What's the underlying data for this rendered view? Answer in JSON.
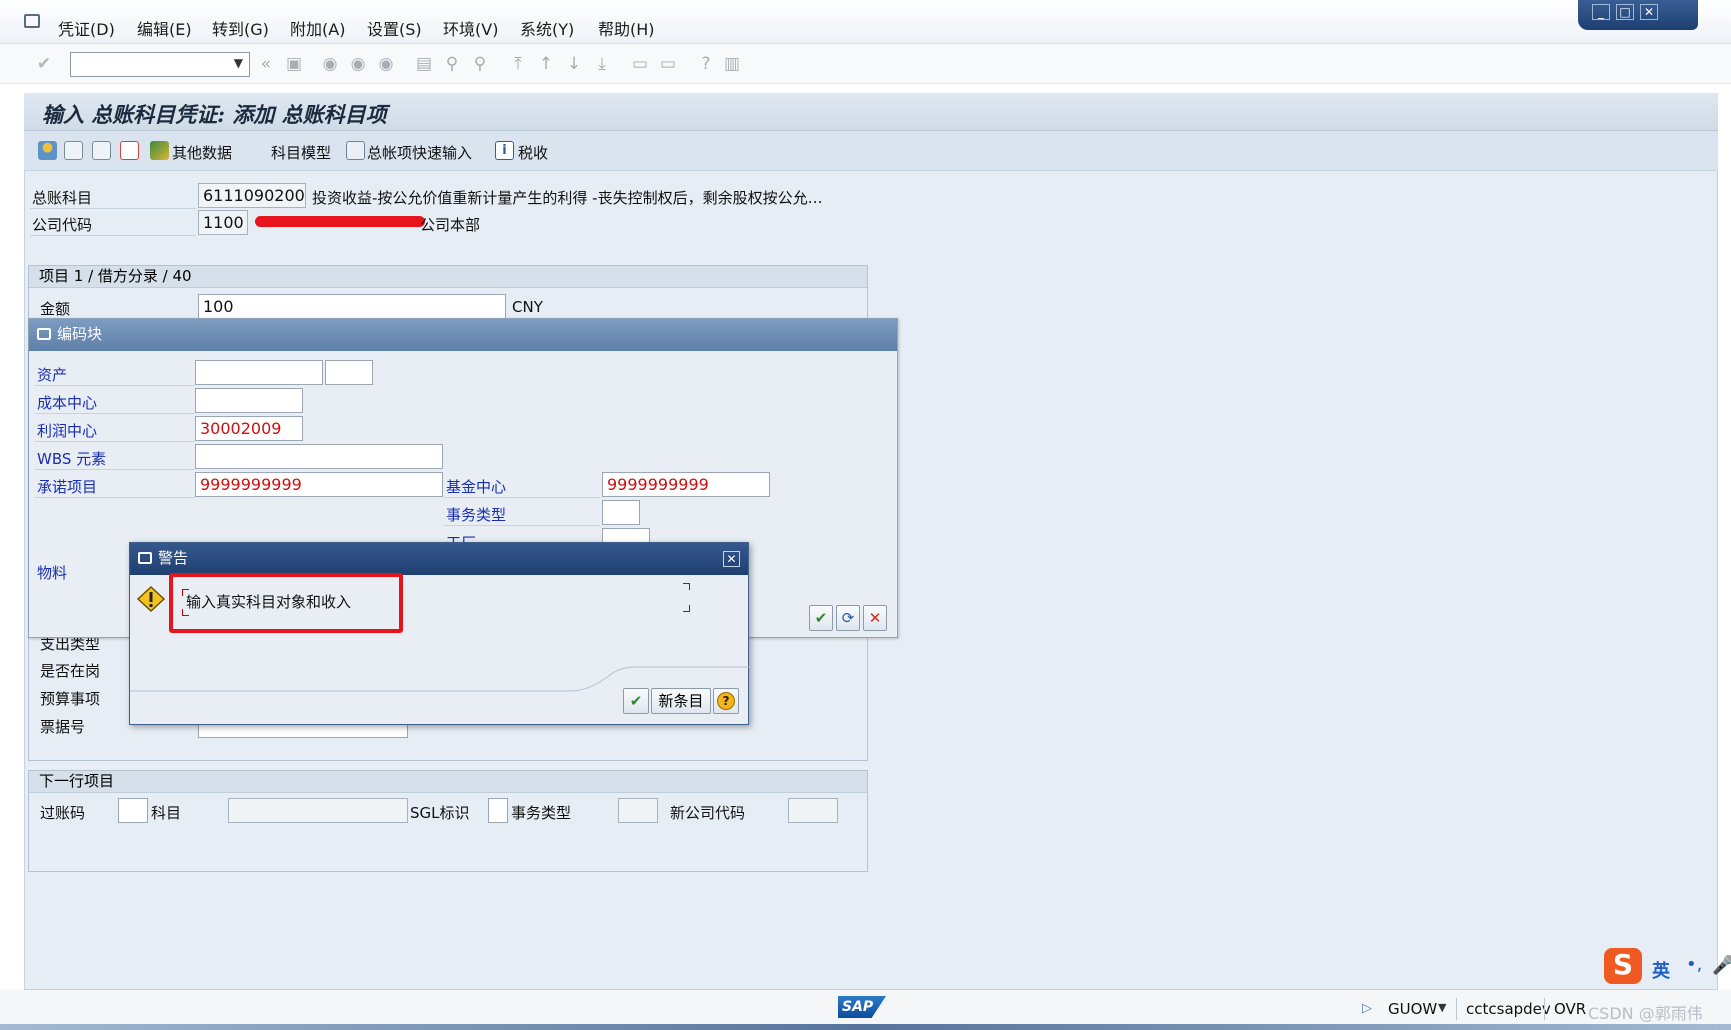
{
  "menu": {
    "items": [
      "凭证(D)",
      "编辑(E)",
      "转到(G)",
      "附加(A)",
      "设置(S)",
      "环境(V)",
      "系统(Y)",
      "帮助(H)"
    ]
  },
  "window_controls": {
    "minimize": "_",
    "maximize": "□",
    "close": "✕"
  },
  "toolbar": {
    "command_field_value": "",
    "back_glyph": "«"
  },
  "page": {
    "title": "输入 总账科目凭证: 添加 总账科目项"
  },
  "app_toolbar": {
    "other_data": "其他数据",
    "account_model": "科目模型",
    "fast_entry": "总帐项快速输入",
    "tax": "税收"
  },
  "header": {
    "gl_account_label": "总账科目",
    "gl_account_value": "6111090200",
    "gl_account_desc": "投资收益-按公允价值重新计量产生的利得 -丧失控制权后，剩余股权按公允…",
    "company_code_label": "公司代码",
    "company_code_value": "1100",
    "company_code_desc": "公司本部"
  },
  "item": {
    "group_title": "项目 1 / 借方分录 / 40",
    "amount_label": "金额",
    "amount_value": "100",
    "currency": "CNY"
  },
  "coding": {
    "title": "编码块",
    "asset_label": "资产",
    "cost_center_label": "成本中心",
    "profit_center_label": "利润中心",
    "profit_center_value": "30002009",
    "wbs_label": "WBS 元素",
    "commitment_label": "承诺项目",
    "commitment_value": "9999999999",
    "fund_center_label": "基金中心",
    "fund_center_value": "9999999999",
    "trans_type_label": "事务类型",
    "plant_label": "工厂",
    "material_label": "物料"
  },
  "extra_fields": {
    "expense_type": "支出类型",
    "on_duty": "是否在岗",
    "budget_item": "预算事项",
    "voucher_no": "票据号"
  },
  "next_item": {
    "title": "下一行项目",
    "posting_key": "过账码",
    "account": "科目",
    "sgl": "SGL标识",
    "trans_type": "事务类型",
    "new_company": "新公司代码"
  },
  "warning": {
    "title": "警告",
    "message": "输入真实科目对象和收入",
    "new_entry_button": "新条目",
    "close_glyph": "✕"
  },
  "status": {
    "user": "GUOW",
    "system": "cctcsapdev",
    "mode": "OVR",
    "sap_logo": "SAP",
    "watermark": "CSDN @郭雨伟",
    "ime": "英"
  },
  "colors": {
    "title_bg": "#cfdbe7",
    "dialog_header": "#1f3f70",
    "required_red": "#cc1010",
    "label_blue": "#1a2fb0",
    "highlight_red": "#e8141b"
  }
}
